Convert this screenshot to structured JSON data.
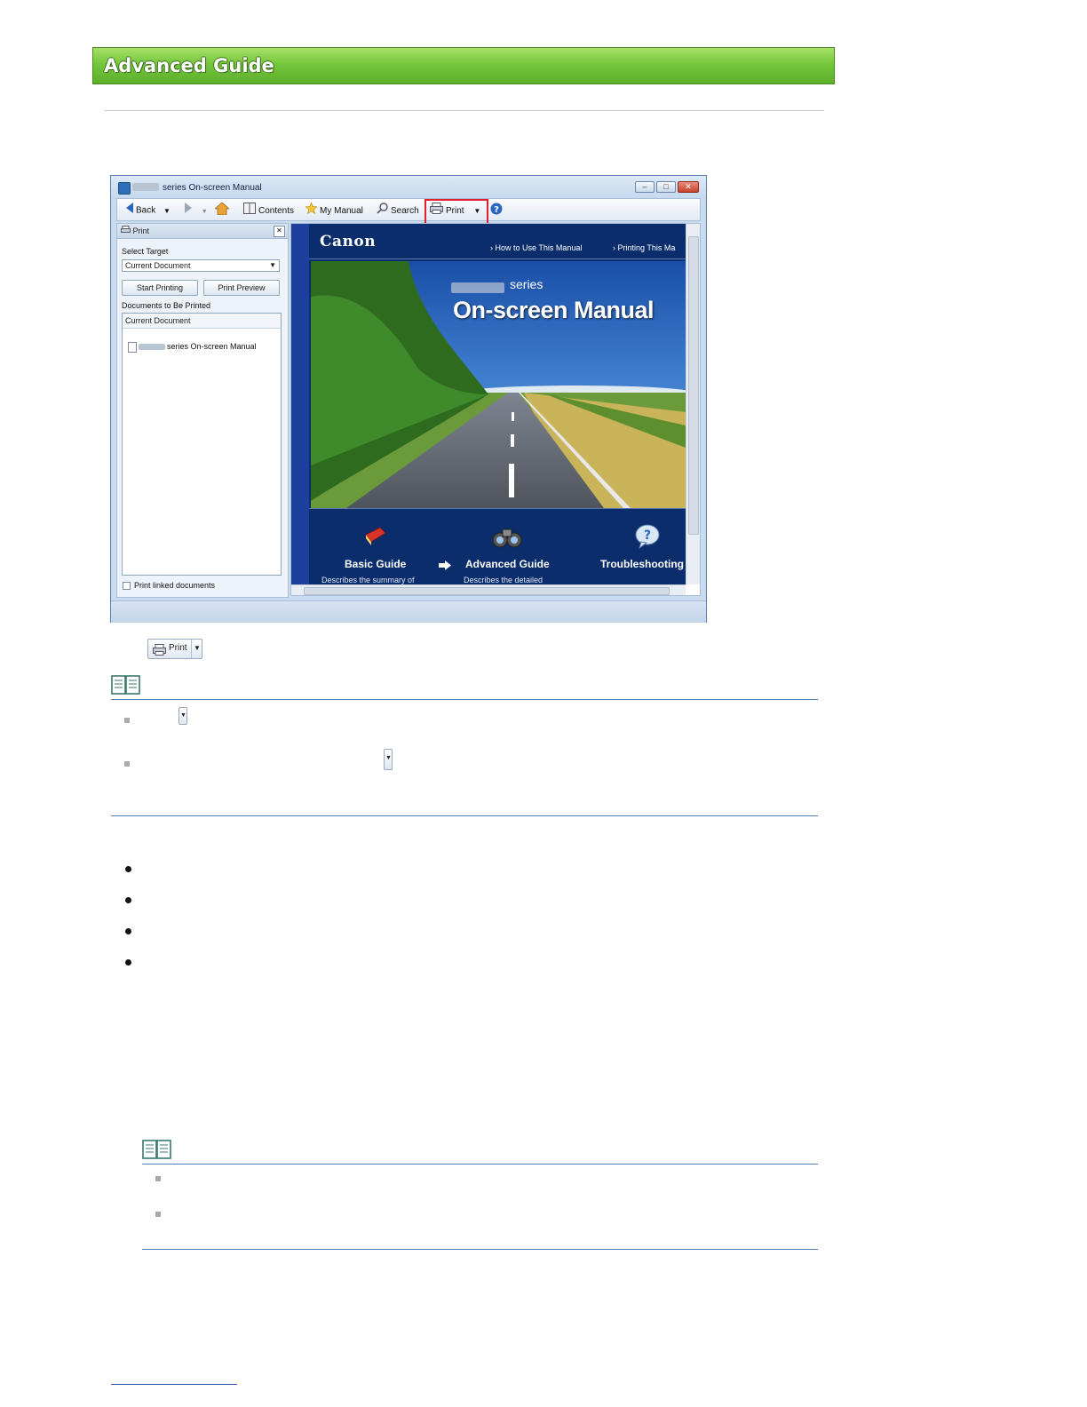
{
  "banner": {
    "title": "Advanced Guide"
  },
  "window": {
    "title": "series On-screen Manual",
    "toolbar": {
      "back": "Back",
      "contents": "Contents",
      "my_manual": "My Manual",
      "search": "Search",
      "print": "Print"
    },
    "print_pane": {
      "header": "Print",
      "select_target_label": "Select Target",
      "select_target_value": "Current Document",
      "start_printing": "Start Printing",
      "print_preview": "Print Preview",
      "documents_label": "Documents to Be Printed",
      "list_header": "Current Document",
      "list_item": "series On-screen Manual",
      "print_linked": "Print linked documents"
    },
    "manual_page": {
      "brand": "Canon",
      "link_how_to": "How to Use This Manual",
      "link_printing": "Printing This Ma",
      "series": "series",
      "main_title": "On-screen Manual",
      "guides": [
        {
          "title": "Basic Guide",
          "desc": "Describes the summary of"
        },
        {
          "title": "Advanced Guide",
          "desc": "Describes the detailed"
        },
        {
          "title": "Troubleshooting",
          "desc": ""
        }
      ]
    }
  },
  "print_button_image": {
    "label": "Print"
  },
  "colors": {
    "banner_green": "#74c63a",
    "highlight_red": "#e0202a",
    "canon_navy": "#0b2d6b"
  }
}
